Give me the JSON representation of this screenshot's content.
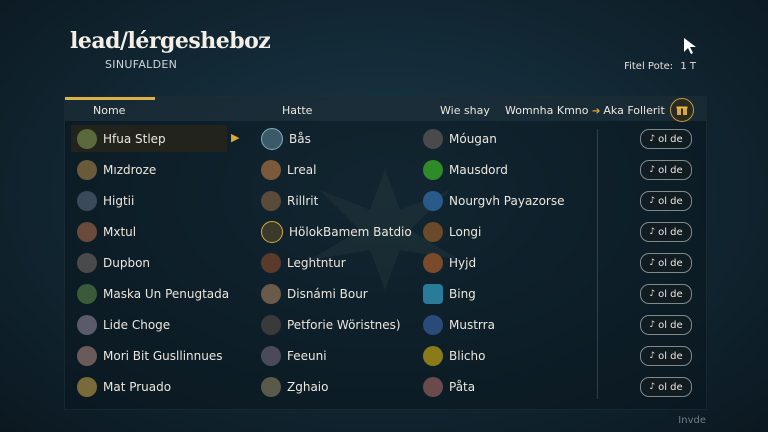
{
  "app": {
    "title": "lead/lérgesheboz",
    "subtitle": "SINUFALDEN"
  },
  "top_stats": {
    "label": "Fitel Pote:",
    "value": "1 T"
  },
  "header": {
    "col1": "Nome",
    "col2": "Hatte",
    "col3": "Wie shay",
    "col4": "Womnha Kmno",
    "col5": "Aka Follerit"
  },
  "rows": [
    {
      "c1": "Hfua Stlep",
      "c2": "Bås",
      "c3": "Móugan",
      "action": "ol de"
    },
    {
      "c1": "Mızdroze",
      "c2": "Lreal",
      "c3": "Mausdord",
      "action": "ol de"
    },
    {
      "c1": "Higtii",
      "c2": "Rillrit",
      "c3": "Nourgvh Payazorse",
      "action": "ol de"
    },
    {
      "c1": "Mxtul",
      "c2": "HölokBamem Batdio",
      "c3": "Longi",
      "action": "ol de"
    },
    {
      "c1": "Dupbon",
      "c2": "Leghtntur",
      "c3": "Hyjd",
      "action": "ol de"
    },
    {
      "c1": "Maska Un Penugtada",
      "c2": "Disnámi Bour",
      "c3": "Bing",
      "action": "ol de"
    },
    {
      "c1": "Lide Choge",
      "c2": "Petforie Wöristnes)",
      "c3": "Mustrra",
      "action": "ol de"
    },
    {
      "c1": "Mori Bit Gusllinnues",
      "c2": "Feeuni",
      "c3": "Blicho",
      "action": "ol de"
    },
    {
      "c1": "Mat Pruado",
      "c2": "Zghaio",
      "c3": "Påta",
      "action": "ol de"
    }
  ],
  "footer": {
    "text": "Invde"
  },
  "colors": {
    "accent": "#d8b24a",
    "arrow": "#e0a630"
  }
}
